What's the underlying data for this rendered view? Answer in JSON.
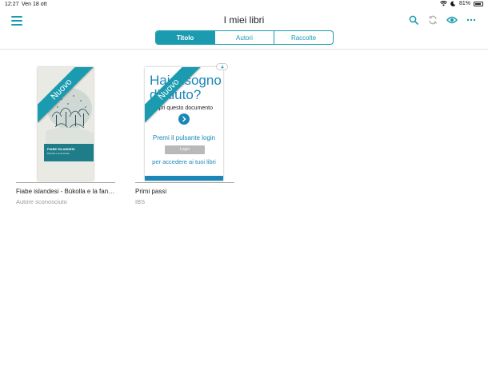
{
  "status_bar": {
    "time": "12:27",
    "date": "Ven 18 ott",
    "battery": "81%"
  },
  "header": {
    "title": "I miei libri",
    "icons": [
      "menu-icon",
      "search-icon",
      "sync-icon",
      "eye-icon",
      "more-icon"
    ]
  },
  "tabs": [
    {
      "label": "Titolo",
      "active": true
    },
    {
      "label": "Autori",
      "active": false
    },
    {
      "label": "Raccolte",
      "active": false
    }
  ],
  "books": [
    {
      "title": "Fiabe islandesi - Búkolla e la fanc...",
      "author": "Autore sconosciuto",
      "badge": "Nuovo",
      "cover_title": "FIABE ISLANDESI",
      "cover_subtitle": "Búkolla e la fanciulla..."
    },
    {
      "title": "Primi passi",
      "author": "IBS",
      "badge": "Nuovo",
      "cover_heading": "Hai bisogno di aiuto?",
      "cover_apri": "Apri questo documento",
      "cover_premi": "Premi il pulsante login",
      "cover_login": "Login",
      "cover_accedere": "per accedere ai tuoi libri"
    }
  ],
  "colors": {
    "accent": "#1b9bb0",
    "cover_blue": "#1b86b8"
  }
}
